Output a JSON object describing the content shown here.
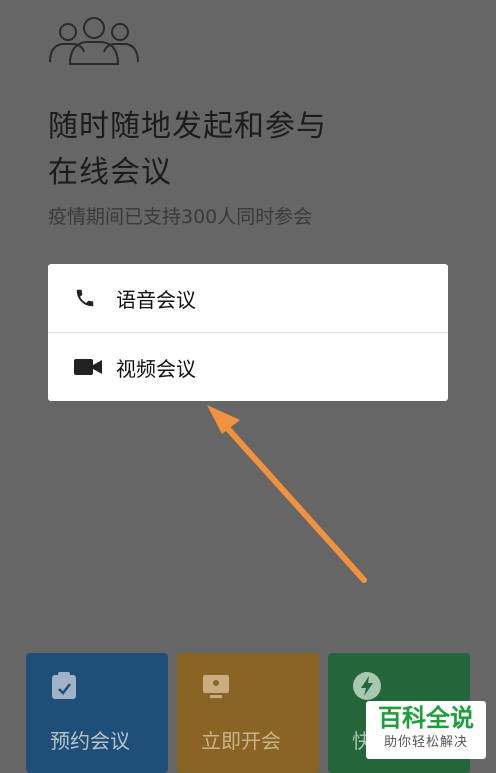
{
  "header": {
    "icon": "users-icon",
    "title_line1": "随时随地发起和参与",
    "title_line2": "在线会议",
    "subtitle": "疫情期间已支持300人同时参会"
  },
  "popup_menu": {
    "items": [
      {
        "label": "语音会议",
        "icon": "phone-icon"
      },
      {
        "label": "视频会议",
        "icon": "video-camera-icon"
      }
    ]
  },
  "annotation": {
    "icon": "arrow-pointer-icon",
    "color": "#f0923e"
  },
  "action_cards": [
    {
      "label": "预约会议",
      "icon": "calendar-clipboard-icon",
      "color": "#1f4f78"
    },
    {
      "label": "立即开会",
      "icon": "monitor-icon",
      "color": "#8a6424"
    },
    {
      "label": "快",
      "icon": "lightning-icon",
      "color": "#24653a"
    }
  ],
  "watermark": {
    "main": "百科全说",
    "sub": "助你轻松解决",
    "color": "#1e9e3a"
  }
}
